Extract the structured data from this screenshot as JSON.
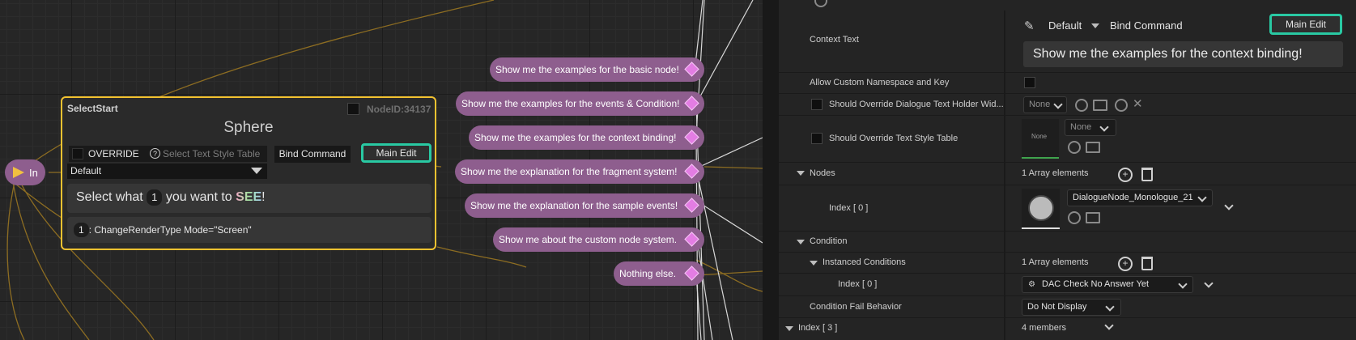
{
  "graph": {
    "in_pin_label": "In",
    "node": {
      "header": "SelectStart",
      "node_id": "NodeID:34137",
      "title": "Sphere",
      "override_label": "OVERRIDE",
      "text_style_placeholder": "Select Text Style Table",
      "default_value": "Default",
      "bind_command_label": "Bind Command",
      "main_edit_label": "Main Edit",
      "row1": {
        "prefix": "Select what",
        "chip": "1",
        "middle": "you want to",
        "highlight": "SEE",
        "suffix": "!"
      },
      "row2": {
        "chip": "1",
        "text": ": ChangeRenderType Mode=\"Screen\""
      }
    },
    "options": [
      "Show me the examples for the basic node!",
      "Show me the examples for the events & Condition!",
      "Show me the examples for the context binding!",
      "Show me the explanation for the fragment system!",
      "Show me the explanation for the sample events!",
      "Show me about the custom node system.",
      "Nothing else."
    ]
  },
  "details": {
    "context_text": {
      "label": "Context Text",
      "style_value": "Default",
      "bind_command_label": "Bind Command",
      "main_edit_label": "Main Edit",
      "value": "Show me the examples for the context binding!"
    },
    "allow_custom_namespace": {
      "label": "Allow Custom Namespace and Key"
    },
    "override_holder": {
      "label": "Should Override Dialogue Text Holder Wid...",
      "value": "None"
    },
    "override_style_table": {
      "label": "Should Override Text Style Table",
      "thumb_label": "None",
      "value": "None"
    },
    "nodes": {
      "label": "Nodes",
      "count": "1 Array elements",
      "index_label": "Index [ 0 ]",
      "value": "DialogueNode_Monologue_21"
    },
    "condition": {
      "label": "Condition",
      "instanced_label": "Instanced Conditions",
      "count": "1 Array elements",
      "index_label": "Index [ 0 ]",
      "value": "DAC Check No Answer Yet"
    },
    "fail_behavior": {
      "label": "Condition Fail Behavior",
      "value": "Do Not Display"
    },
    "index3": {
      "label": "Index [ 3 ]",
      "value": "4 members"
    }
  },
  "colors": {
    "node_border": "#f2c230",
    "main_edit_border": "#29c9a3",
    "option_bubble": "#8e5e8e",
    "option_diamond": "#e37de3",
    "wire": "#b48a2a"
  }
}
